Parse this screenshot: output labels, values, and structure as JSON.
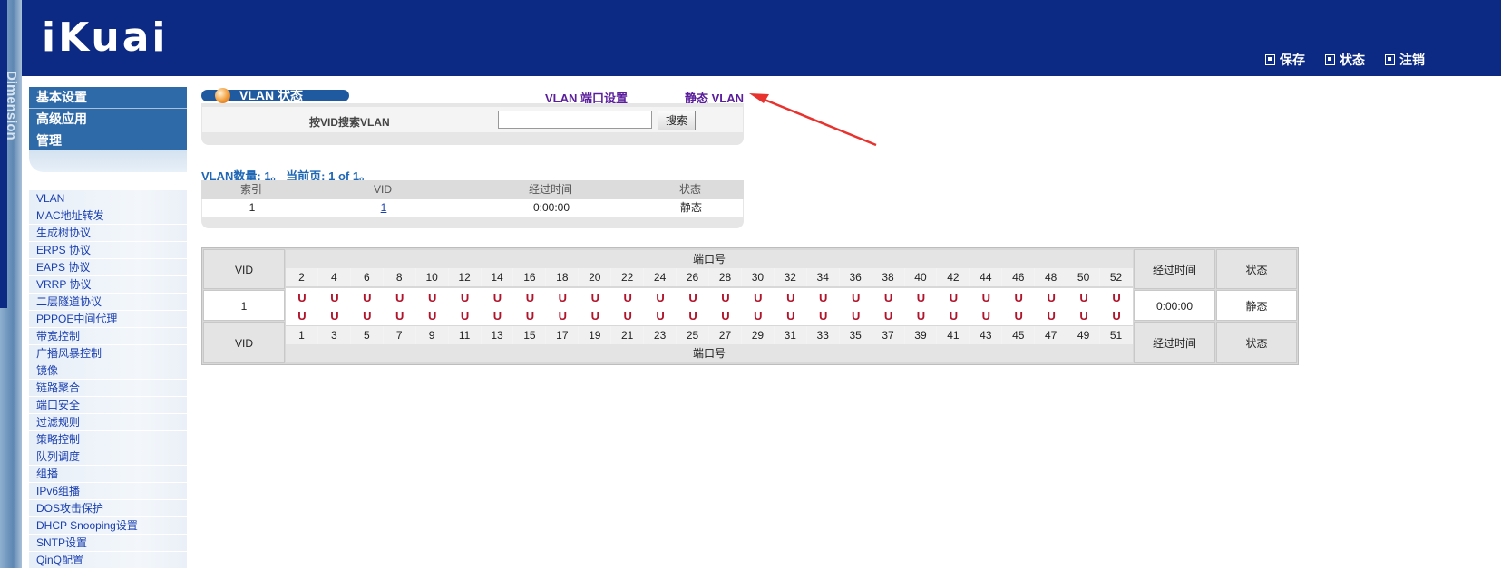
{
  "brand": {
    "logo": "iKuai",
    "strip": "Dimension"
  },
  "header": {
    "actions": [
      {
        "label": "保存",
        "icon": "save-icon"
      },
      {
        "label": "状态",
        "icon": "status-icon"
      },
      {
        "label": "注销",
        "icon": "logout-icon"
      }
    ]
  },
  "sidebar": {
    "main_menu": [
      "基本设置",
      "高级应用",
      "管理"
    ],
    "sub_menu": [
      "VLAN",
      "MAC地址转发",
      "生成树协议",
      "ERPS 协议",
      "EAPS 协议",
      "VRRP 协议",
      "二层隧道协议",
      "PPPOE中间代理",
      "带宽控制",
      "广播风暴控制",
      "镜像",
      "链路聚合",
      "端口安全",
      "过滤规则",
      "策略控制",
      "队列调度",
      "组播",
      "IPv6组播",
      "DOS攻击保护",
      "DHCP Snooping设置",
      "SNTP设置",
      "QinQ配置"
    ]
  },
  "content": {
    "title": "VLAN 状态",
    "links": {
      "port_setting": "VLAN 端口设置",
      "static_vlan": "静态 VLAN"
    },
    "search": {
      "label": "按VID搜索VLAN",
      "value": "",
      "placeholder": "",
      "button": "搜索"
    },
    "count_text": "VLAN数量: 1。 当前页: 1 of 1。",
    "list": {
      "headers": [
        "索引",
        "VID",
        "经过时间",
        "状态"
      ],
      "rows": [
        {
          "index": "1",
          "vid": "1",
          "elapsed": "0:00:00",
          "state": "静态"
        }
      ]
    },
    "port_table": {
      "vid_label": "VID",
      "port_label": "端口号",
      "elapsed_label": "经过时间",
      "state_label": "状态",
      "top_ports": [
        "2",
        "4",
        "6",
        "8",
        "10",
        "12",
        "14",
        "16",
        "18",
        "20",
        "22",
        "24",
        "26",
        "28",
        "30",
        "32",
        "34",
        "36",
        "38",
        "40",
        "42",
        "44",
        "46",
        "48",
        "50",
        "52"
      ],
      "bottom_ports": [
        "1",
        "3",
        "5",
        "7",
        "9",
        "11",
        "13",
        "15",
        "17",
        "19",
        "21",
        "23",
        "25",
        "27",
        "29",
        "31",
        "33",
        "35",
        "37",
        "39",
        "41",
        "43",
        "45",
        "47",
        "49",
        "51"
      ],
      "row": {
        "vid": "1",
        "elapsed": "0:00:00",
        "state": "静态",
        "top_flags": [
          "U",
          "U",
          "U",
          "U",
          "U",
          "U",
          "U",
          "U",
          "U",
          "U",
          "U",
          "U",
          "U",
          "U",
          "U",
          "U",
          "U",
          "U",
          "U",
          "U",
          "U",
          "U",
          "U",
          "U",
          "U",
          "U"
        ],
        "bottom_flags": [
          "U",
          "U",
          "U",
          "U",
          "U",
          "U",
          "U",
          "U",
          "U",
          "U",
          "U",
          "U",
          "U",
          "U",
          "U",
          "U",
          "U",
          "U",
          "U",
          "U",
          "U",
          "U",
          "U",
          "U",
          "U",
          "U"
        ]
      }
    }
  },
  "colors": {
    "header_bg": "#0c2a84",
    "menu_bg": "#2f6aa8",
    "link": "#5a1e9c",
    "untagged": "#b0132a",
    "count_text": "#1f67b4"
  }
}
